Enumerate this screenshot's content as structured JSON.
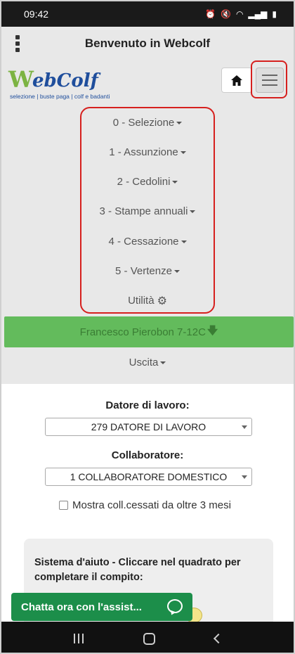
{
  "status_bar": {
    "time": "09:42",
    "icons": [
      "alarm-icon",
      "mute-icon",
      "wifi-icon",
      "signal-icon",
      "battery-icon"
    ]
  },
  "header": {
    "title": "Benvenuto in Webcolf"
  },
  "logo": {
    "word_v": "W",
    "word_eb": "eb",
    "word_colf": "Colf",
    "tagline": "selezione | buste paga | colf e badanti"
  },
  "menu": {
    "items": [
      {
        "label": "0 - Selezione"
      },
      {
        "label": "1 - Assunzione"
      },
      {
        "label": "2 - Cedolini"
      },
      {
        "label": "3 - Stampe annuali"
      },
      {
        "label": "4 - Cessazione"
      },
      {
        "label": "5 - Vertenze"
      }
    ],
    "utility": "Utilità",
    "user": "Francesco Pierobon 7-12C",
    "exit": "Uscita"
  },
  "form": {
    "employer_label": "Datore di lavoro:",
    "employer_value": "279 DATORE DI LAVORO",
    "collaborator_label": "Collaboratore:",
    "collaborator_value": "1 COLLABORATORE DOMESTICO",
    "checkbox_label": "Mostra coll.cessati da oltre 3 mesi",
    "checkbox_checked": false
  },
  "help": {
    "text": "Sistema d'aiuto - Cliccare nel quadrato per completare il compito:"
  },
  "chat": {
    "label": "Chatta ora con l'assist..."
  },
  "colors": {
    "accent_green": "#63bb5c",
    "chat_green": "#1c8e4a",
    "highlight_red": "#d6201e",
    "logo_blue": "#1f4e9c"
  }
}
